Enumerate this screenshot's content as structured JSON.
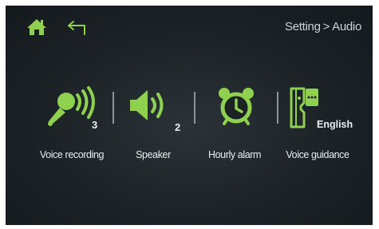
{
  "header": {
    "breadcrumb_parent": "Setting",
    "breadcrumb_separator": ">",
    "breadcrumb_current": "Audio",
    "home_icon": "home-icon",
    "back_icon": "back-arrow-icon"
  },
  "tiles": [
    {
      "id": "voice-recording",
      "label": "Voice recording",
      "value": "3",
      "icon": "microphone-icon"
    },
    {
      "id": "speaker",
      "label": "Speaker",
      "value": "2",
      "icon": "speaker-icon"
    },
    {
      "id": "hourly-alarm",
      "label": "Hourly alarm",
      "icon": "alarm-clock-icon"
    },
    {
      "id": "voice-guidance",
      "label": "Voice guidance",
      "value": "English",
      "icon": "voice-guidance-icon"
    }
  ],
  "colors": {
    "accent": "#8fd14f",
    "background": "#1c2226",
    "text": "#e8eef0"
  }
}
